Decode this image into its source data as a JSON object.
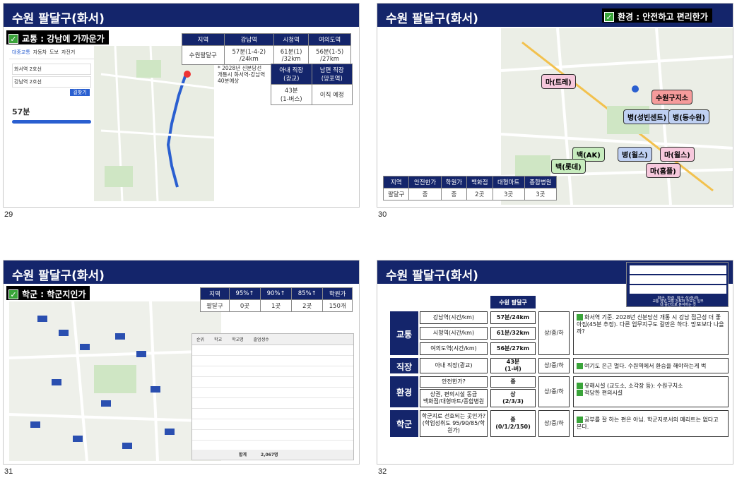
{
  "slides": [
    {
      "number": "29",
      "title": "수원 팔달구(화서)",
      "tag": "교통 : 강남에 가까운가",
      "table": {
        "headers": [
          "지역",
          "강남역",
          "시청역",
          "여의도역"
        ],
        "row": [
          "수원팔달구",
          "57분(1-4-2)\n/24km",
          "61분(1)\n/32km",
          "56분(1-5)\n/27km"
        ]
      },
      "note": "* 2028년 신분당선 개통시 화서역-강남역 40분예상",
      "work_table": {
        "headers": [
          "아내 직장\n(광교)",
          "남편 직장\n(망포역)"
        ],
        "row": [
          "43분\n(1-버스)",
          "이직 예정"
        ]
      },
      "map_panel": {
        "tabs": [
          "대중교통",
          "자동차",
          "도보",
          "자전거"
        ],
        "from": "화서역 2호선",
        "to": "강남역 2호선",
        "time": "57분",
        "search_button": "길찾기"
      }
    },
    {
      "number": "30",
      "title": "수원 팔달구(화서)",
      "tag": "환경 : 안전하고 편리한가",
      "labels": {
        "mart1": "마(트레)",
        "office": "수원구지소",
        "hosp1": "병(성빈센트)",
        "hosp2": "병(동수원)",
        "dept1": "백(AK)",
        "dept2": "백(롯데)",
        "hosp3": "병(윌스)",
        "mart2": "마(윌스)",
        "mart3": "마(홈플)"
      },
      "table": {
        "headers": [
          "지역",
          "안전한가",
          "학원가",
          "백화점",
          "대형마트",
          "종합병원"
        ],
        "row": [
          "팔달구",
          "중",
          "중",
          "2곳",
          "3곳",
          "3곳"
        ]
      }
    },
    {
      "number": "31",
      "title": "수원 팔달구(화서)",
      "tag": "학군 : 학군지인가",
      "table": {
        "headers": [
          "지역",
          "95%↑",
          "90%↑",
          "85%↑",
          "학원가"
        ],
        "row": [
          "팔달구",
          "0곳",
          "1곳",
          "2곳",
          "150개"
        ]
      },
      "school_list_header": [
        "순위",
        "학교",
        "학교명",
        "졸업생수"
      ],
      "total_row": [
        "",
        "",
        "합계",
        "2,067명"
      ]
    },
    {
      "number": "32",
      "title": "수원 팔달구(화서)",
      "column_header": "수원 팔달구",
      "legend_title": "학군, 환경, 학군 상/중/하",
      "legend_note": "교통 상위 교통 검토와 수요는 일부\n내 중간으로 분석하는 것",
      "sections": [
        {
          "category": "교통",
          "items": [
            "강남역(시간/km)",
            "시청역(시간/km)",
            "여의도역(시간/km)"
          ],
          "values": [
            "57분/24km",
            "61분/32km",
            "56분/27km"
          ],
          "grade": "상/중/하",
          "comment": "화서역 기준. 2028년 신분당선 개통 시 강남 접근성 더 좋아짐(45분 추정). 다른 업무지구도 갈만은 하다. 망포보다 나을까?"
        },
        {
          "category": "직장",
          "items": [
            "아내 직장(광교)"
          ],
          "values": [
            "43분\n(1-버)"
          ],
          "grade": "상/중/하",
          "comment": "여기도 은근 멀다. 수원역에서 환승을 해야하는게 벅"
        },
        {
          "category": "환경",
          "items": [
            "안전한가?",
            "상권, 편의시설 동급\n백화점/대형마트/종합병원"
          ],
          "values": [
            "중",
            "상\n(2/3/3)"
          ],
          "grade": "상/중/하",
          "comment_lines": [
            "유해시설 (교도소, 소각장 등): 수원구치소",
            "적당한 편의시설"
          ]
        },
        {
          "category": "학군",
          "items": [
            "학군지로 선호되는 곳인가?\n(학업성취도 95/90/85/학원가)"
          ],
          "values": [
            "중\n(0/1/2/150)"
          ],
          "grade": "상/중/하",
          "comment": "공부를 잘 하는 편은 아님. 학군지로서의 메리트는 없다고 본다."
        }
      ]
    }
  ],
  "colors": {
    "navy": "#14256b",
    "green": "#3aa43a"
  }
}
